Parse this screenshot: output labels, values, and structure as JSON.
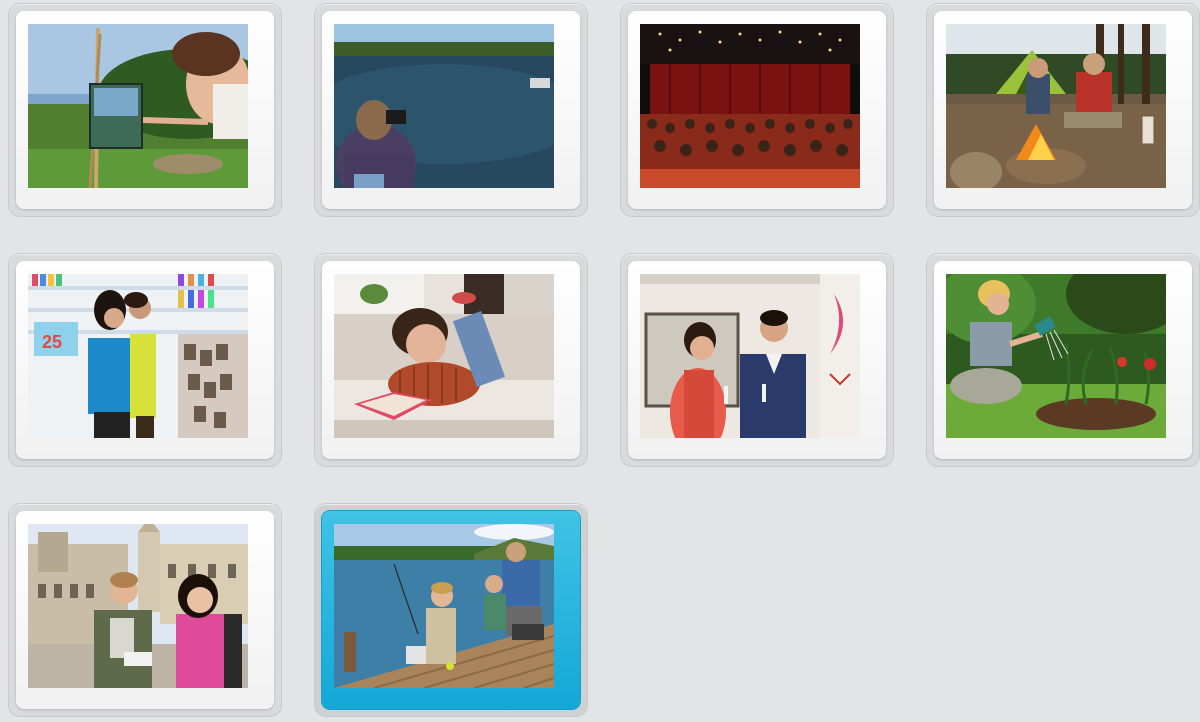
{
  "gallery": {
    "selected_index": 9,
    "selection_color": "#1fb3df",
    "tiles": [
      {
        "name": "painter-at-easel-photo",
        "icon": "woman-painting-landscape"
      },
      {
        "name": "photographer-at-lake-photo",
        "icon": "woman-photographing-lake"
      },
      {
        "name": "theater-audience-photo",
        "icon": "audience-in-auditorium"
      },
      {
        "name": "campfire-camping-photo",
        "icon": "couple-at-campfire-tent"
      },
      {
        "name": "bookstore-browsing-photo",
        "icon": "women-browsing-bookstore"
      },
      {
        "name": "reading-on-sofa-photo",
        "icon": "girl-reading-on-sofa"
      },
      {
        "name": "art-gallery-couple-photo",
        "icon": "couple-at-art-gallery"
      },
      {
        "name": "gardening-photo",
        "icon": "woman-watering-garden"
      },
      {
        "name": "tourists-in-city-photo",
        "icon": "tourists-in-old-town"
      },
      {
        "name": "fishing-on-dock-photo",
        "icon": "family-fishing-from-dock"
      }
    ]
  }
}
